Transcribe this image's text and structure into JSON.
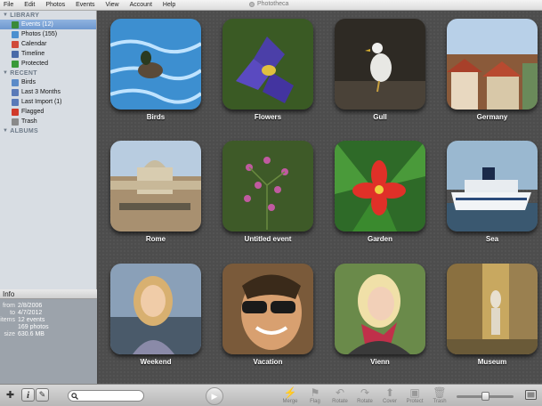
{
  "menubar": {
    "items": [
      "File",
      "Edit",
      "Photos",
      "Events",
      "View",
      "Account",
      "Help"
    ],
    "app_title": "Phototheca"
  },
  "sidebar": {
    "library_header": "LIBRARY",
    "library_items": [
      {
        "label": "Events (12)",
        "icon": "events-icon",
        "color": "#3a8a3a",
        "selected": true
      },
      {
        "label": "Photos (155)",
        "icon": "photos-icon",
        "color": "#4a8fcf"
      },
      {
        "label": "Calendar",
        "icon": "calendar-icon",
        "color": "#d04a3a"
      },
      {
        "label": "Timeline",
        "icon": "timeline-icon",
        "color": "#4a6aa8"
      },
      {
        "label": "Protected",
        "icon": "protected-icon",
        "color": "#3a9a3a"
      }
    ],
    "recent_header": "RECENT",
    "recent_items": [
      {
        "label": "Birds",
        "icon": "event-icon",
        "color": "#5a8ac8"
      },
      {
        "label": "Last 3 Months",
        "icon": "clock-icon",
        "color": "#5a7ab8"
      },
      {
        "label": "Last Import (1)",
        "icon": "import-icon",
        "color": "#5a7ab8"
      },
      {
        "label": "Flagged",
        "icon": "flag-icon",
        "color": "#d03a2a"
      },
      {
        "label": "Trash",
        "icon": "trash-icon",
        "color": "#8a8a8a"
      }
    ],
    "albums_header": "ALBUMS"
  },
  "info": {
    "title": "Info",
    "rows": [
      {
        "k": "from",
        "v": "2/8/2006"
      },
      {
        "k": "to",
        "v": "4/7/2012"
      },
      {
        "k": "items",
        "v": "12 events"
      },
      {
        "k": "",
        "v": "169 photos"
      },
      {
        "k": "size",
        "v": "630.6 MB"
      }
    ]
  },
  "events": [
    {
      "label": "Birds",
      "scene": "water"
    },
    {
      "label": "Flowers",
      "scene": "iris"
    },
    {
      "label": "Gull",
      "scene": "gull"
    },
    {
      "label": "Germany",
      "scene": "town"
    },
    {
      "label": "Rome",
      "scene": "rome"
    },
    {
      "label": "Untitled event",
      "scene": "pink"
    },
    {
      "label": "Garden",
      "scene": "redflower"
    },
    {
      "label": "Sea",
      "scene": "ship"
    },
    {
      "label": "Weekend",
      "scene": "woman1"
    },
    {
      "label": "Vacation",
      "scene": "man"
    },
    {
      "label": "Vienn",
      "scene": "woman2"
    },
    {
      "label": "Museum",
      "scene": "museum"
    }
  ],
  "toolbar": {
    "search_placeholder": "",
    "tools": [
      {
        "label": "Merge",
        "icon": "merge-icon"
      },
      {
        "label": "Flag",
        "icon": "flag-icon"
      },
      {
        "label": "Rotate",
        "icon": "rotate-left-icon"
      },
      {
        "label": "Rotate",
        "icon": "rotate-right-icon"
      },
      {
        "label": "Cover",
        "icon": "cover-icon"
      },
      {
        "label": "Protect",
        "icon": "protect-icon"
      },
      {
        "label": "Trash",
        "icon": "trash-icon"
      }
    ],
    "zoom_level": 0.5
  }
}
